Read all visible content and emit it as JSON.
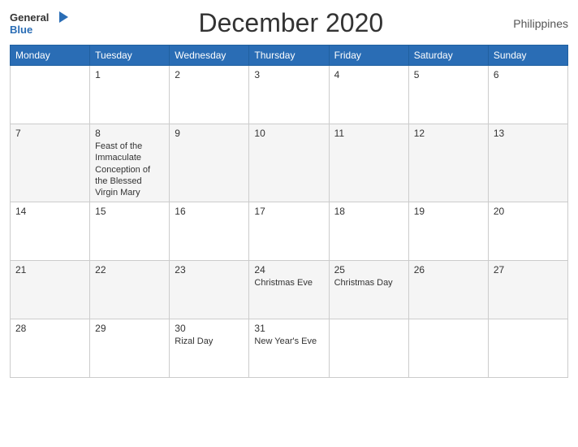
{
  "header": {
    "logo_general": "General",
    "logo_blue": "Blue",
    "title": "December 2020",
    "country": "Philippines"
  },
  "weekdays": [
    "Monday",
    "Tuesday",
    "Wednesday",
    "Thursday",
    "Friday",
    "Saturday",
    "Sunday"
  ],
  "weeks": [
    [
      {
        "day": "",
        "event": ""
      },
      {
        "day": "1",
        "event": ""
      },
      {
        "day": "2",
        "event": ""
      },
      {
        "day": "3",
        "event": ""
      },
      {
        "day": "4",
        "event": ""
      },
      {
        "day": "5",
        "event": ""
      },
      {
        "day": "6",
        "event": ""
      }
    ],
    [
      {
        "day": "7",
        "event": ""
      },
      {
        "day": "8",
        "event": "Feast of the Immaculate Conception of the Blessed Virgin Mary"
      },
      {
        "day": "9",
        "event": ""
      },
      {
        "day": "10",
        "event": ""
      },
      {
        "day": "11",
        "event": ""
      },
      {
        "day": "12",
        "event": ""
      },
      {
        "day": "13",
        "event": ""
      }
    ],
    [
      {
        "day": "14",
        "event": ""
      },
      {
        "day": "15",
        "event": ""
      },
      {
        "day": "16",
        "event": ""
      },
      {
        "day": "17",
        "event": ""
      },
      {
        "day": "18",
        "event": ""
      },
      {
        "day": "19",
        "event": ""
      },
      {
        "day": "20",
        "event": ""
      }
    ],
    [
      {
        "day": "21",
        "event": ""
      },
      {
        "day": "22",
        "event": ""
      },
      {
        "day": "23",
        "event": ""
      },
      {
        "day": "24",
        "event": "Christmas Eve"
      },
      {
        "day": "25",
        "event": "Christmas Day"
      },
      {
        "day": "26",
        "event": ""
      },
      {
        "day": "27",
        "event": ""
      }
    ],
    [
      {
        "day": "28",
        "event": ""
      },
      {
        "day": "29",
        "event": ""
      },
      {
        "day": "30",
        "event": "Rizal Day"
      },
      {
        "day": "31",
        "event": "New Year's Eve"
      },
      {
        "day": "",
        "event": ""
      },
      {
        "day": "",
        "event": ""
      },
      {
        "day": "",
        "event": ""
      }
    ]
  ]
}
